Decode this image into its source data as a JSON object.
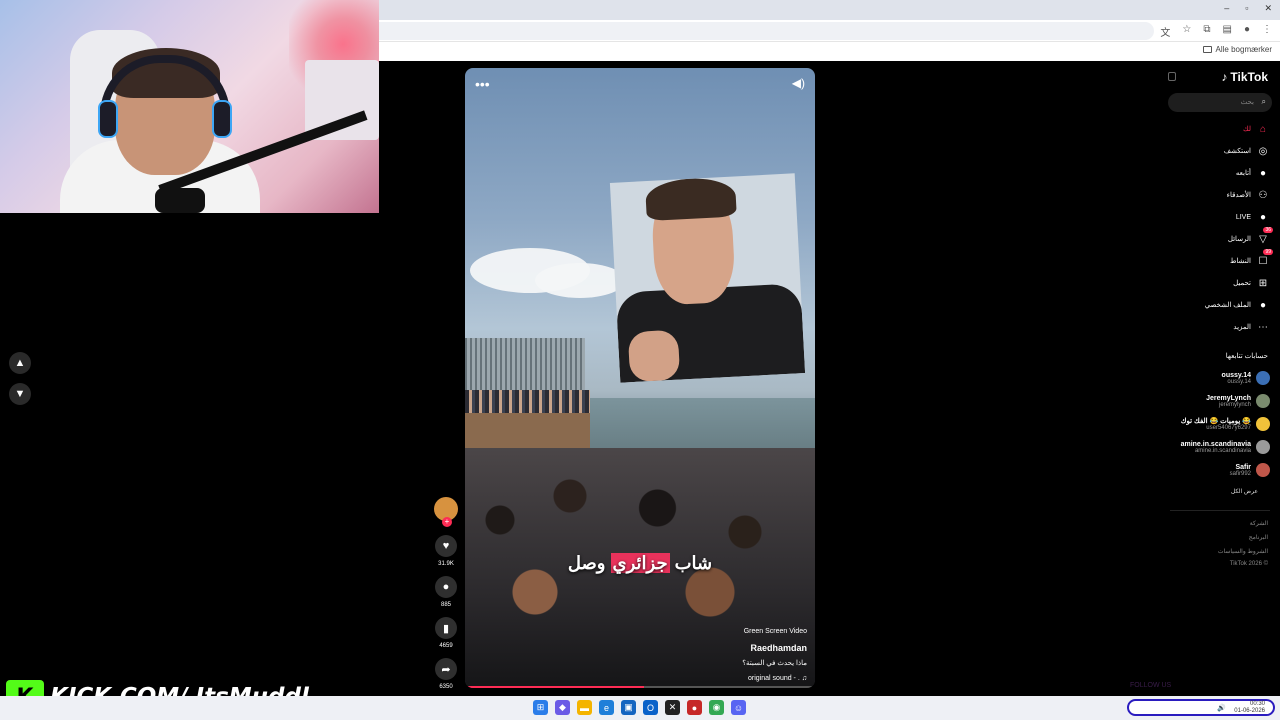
{
  "browser": {
    "bookmarks_label": "Alle bogmærker"
  },
  "overlay": {
    "kick_logo": "K",
    "kick_text": "KICK.COM/ ItsMuddl",
    "ticker_text": "FOLLOW US"
  },
  "video": {
    "menu_label": "•••",
    "caption_before": "شاب",
    "caption_highlight": "جزائري",
    "caption_after": "وصل",
    "tag": "Green Screen Video",
    "author": "Raedhamdan",
    "description": "ماذا يحدث في السبتة؟",
    "sound": "original sound - .",
    "progress": 0.51
  },
  "actions": {
    "likes": "31.9K",
    "comments": "885",
    "saves": "4659",
    "shares": "6350"
  },
  "tiktok": {
    "logo": "TikTok",
    "search_placeholder": "بحث",
    "nav": [
      {
        "label": "لك",
        "icon": "home-icon",
        "badge": "",
        "active": true
      },
      {
        "label": "استكشف",
        "icon": "compass-icon",
        "badge": "",
        "active": false
      },
      {
        "label": "أتابعه",
        "icon": "following-avatar-icon",
        "badge": "",
        "active": false
      },
      {
        "label": "الأصدقاء",
        "icon": "friends-icon",
        "badge": "",
        "active": false
      },
      {
        "label": "LIVE",
        "icon": "live-avatar-icon",
        "badge": "",
        "active": false
      },
      {
        "label": "الرسائل",
        "icon": "messages-icon",
        "badge": "36",
        "active": false
      },
      {
        "label": "النشاط",
        "icon": "activity-icon",
        "badge": "99",
        "active": false
      },
      {
        "label": "تحميل",
        "icon": "upload-icon",
        "badge": "",
        "active": false
      },
      {
        "label": "الملف الشخصي",
        "icon": "profile-icon",
        "badge": "",
        "active": false
      },
      {
        "label": "المزيد",
        "icon": "more-icon",
        "badge": "",
        "active": false
      }
    ],
    "following_title": "حسابات تتابعها",
    "following": [
      {
        "name": "oussy.14",
        "handle": "oussy.14",
        "color": "#3b6fb5"
      },
      {
        "name": "JeremyLynch",
        "handle": "jeremylynch",
        "color": "#7a8b6e"
      },
      {
        "name": "يوميات 😂 الفك توك 😂",
        "handle": "user54067y6297",
        "color": "#f0c23a"
      },
      {
        "name": "amine.in.scandinavia",
        "handle": "amine.in.scandinavia",
        "color": "#9a9a9a"
      },
      {
        "name": "Safir",
        "handle": "safir992",
        "color": "#c0574a"
      }
    ],
    "see_all": "عرض الكل",
    "footer": [
      "الشركة",
      "البرنامج",
      "الشروط والسياسات",
      "TikTok 2026 ©"
    ]
  },
  "taskbar": {
    "time": "00:30",
    "date": "01-06-2026"
  }
}
